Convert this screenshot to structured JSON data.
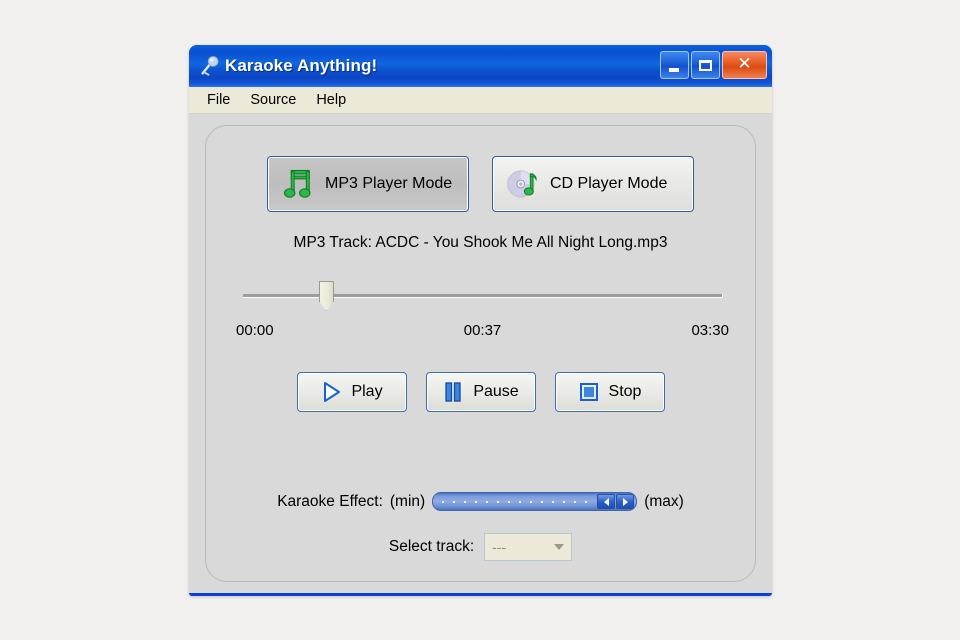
{
  "window": {
    "title": "Karaoke Anything!",
    "title_icon": "microphone-icon",
    "controls": {
      "minimize": "minimize-icon",
      "maximize": "maximize-icon",
      "close": "close-icon"
    }
  },
  "menubar": {
    "items": [
      {
        "label": "File"
      },
      {
        "label": "Source"
      },
      {
        "label": "Help"
      }
    ]
  },
  "modes": {
    "mp3": {
      "label": "MP3 Player Mode",
      "icon": "music-note-icon",
      "selected": true
    },
    "cd": {
      "label": "CD Player Mode",
      "icon": "cd-disc-note-icon",
      "selected": false
    }
  },
  "track": {
    "label": "MP3 Track: ACDC - You Shook Me All Night Long.mp3"
  },
  "position": {
    "start_time": "00:00",
    "current_time": "00:37",
    "end_time": "03:30"
  },
  "transport": {
    "play": {
      "label": "Play",
      "icon": "play-triangle-icon"
    },
    "pause": {
      "label": "Pause",
      "icon": "pause-bars-icon"
    },
    "stop": {
      "label": "Stop",
      "icon": "stop-square-icon"
    }
  },
  "effect": {
    "label": "Karaoke Effect:",
    "min_label": "(min)",
    "max_label": "(max)",
    "arrow_left": "scroll-left-icon",
    "arrow_right": "scroll-right-icon"
  },
  "select_track": {
    "label": "Select track:",
    "value": "---",
    "arrow": "chevron-down-icon"
  },
  "colors": {
    "titlebar_blue": "#0a50d2",
    "frame_blue": "#0a3fd4",
    "menubar": "#ece9d8",
    "client": "#d9d9d9",
    "accent_green": "#21a83c",
    "accent_blue": "#1f6fd0",
    "close_red": "#e0501a"
  }
}
